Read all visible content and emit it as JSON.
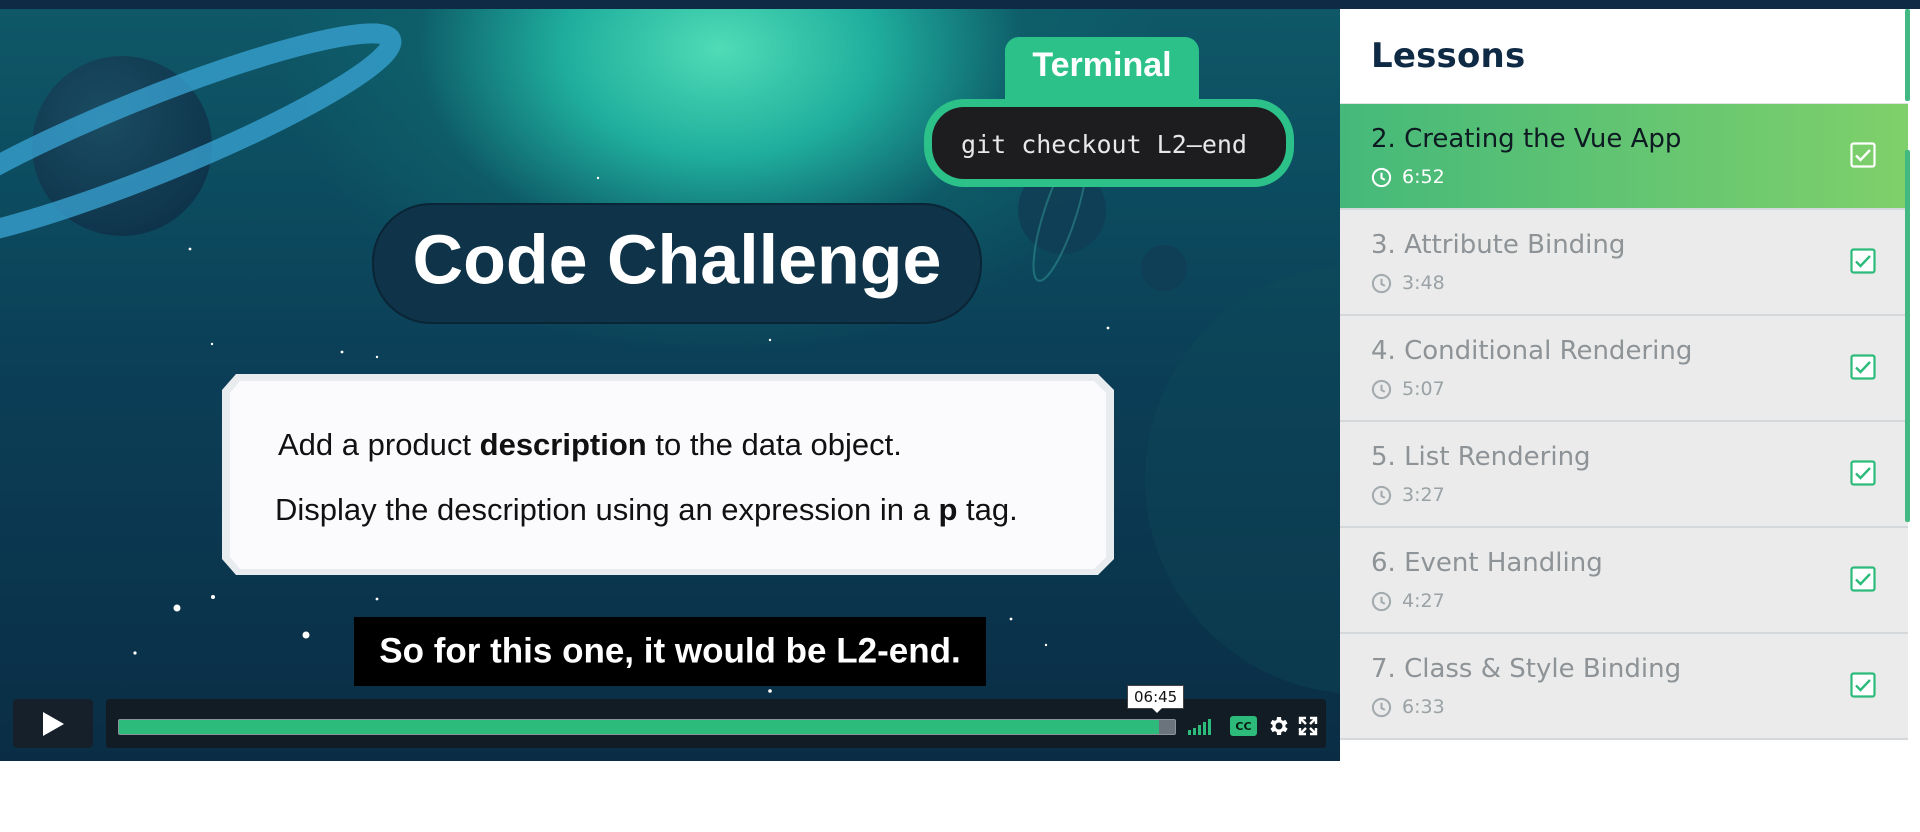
{
  "video": {
    "terminal_label": "Terminal",
    "terminal_command": "git checkout L2–end",
    "challenge_title": "Code Challenge",
    "task_line_1": {
      "pre": "Add a product ",
      "bold": "description",
      "post": " to the data object."
    },
    "task_line_2": {
      "pre": "Display the description using an expression in a ",
      "bold": "p",
      "post": " tag."
    },
    "subtitle": "So for this one, it would be L2-end."
  },
  "player": {
    "current_time": "06:45",
    "progress": 0.985,
    "cc_label": "CC",
    "accent_color": "#2dbb7b"
  },
  "icons": {
    "play": "play-icon",
    "volume": "volume-icon",
    "cc": "closed-captions-icon",
    "settings": "gear-icon",
    "fullscreen": "fullscreen-icon",
    "clock": "clock-icon",
    "check": "checkbox-checked-icon"
  },
  "sidebar": {
    "title": "Lessons",
    "lessons": [
      {
        "label": "2. Creating the Vue App",
        "duration": "6:52",
        "active": true,
        "completed": true
      },
      {
        "label": "3. Attribute Binding",
        "duration": "3:48",
        "active": false,
        "completed": true
      },
      {
        "label": "4. Conditional Rendering",
        "duration": "5:07",
        "active": false,
        "completed": true
      },
      {
        "label": "5. List Rendering",
        "duration": "3:27",
        "active": false,
        "completed": true
      },
      {
        "label": "6. Event Handling",
        "duration": "4:27",
        "active": false,
        "completed": true
      },
      {
        "label": "7. Class & Style Binding",
        "duration": "6:33",
        "active": false,
        "completed": true
      }
    ]
  }
}
